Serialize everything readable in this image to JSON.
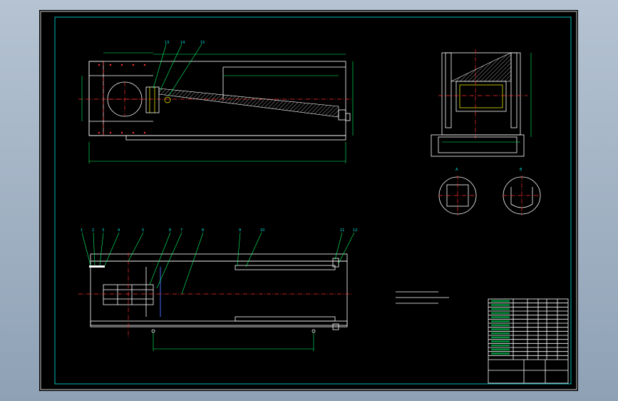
{
  "drawing": {
    "title_block_name": "",
    "title_block_code": "",
    "tech_notes_heading": "",
    "tech_notes": []
  },
  "callouts_top": [
    "13",
    "14",
    "15"
  ],
  "callouts_bottom": [
    "1",
    "2",
    "3",
    "4",
    "5",
    "6",
    "7",
    "8",
    "9",
    "10",
    "11",
    "12"
  ],
  "dimensions": {
    "top_overall": "",
    "bottom_span": ""
  },
  "section_labels": [
    "A",
    "B"
  ],
  "colors": {
    "background": "#000000",
    "frame": "#00e5e5",
    "outline": "#ffffff",
    "dimension": "#00ff66",
    "centerline": "#ff3030",
    "leader": "#ffff00"
  },
  "parts_list_rows": 15
}
